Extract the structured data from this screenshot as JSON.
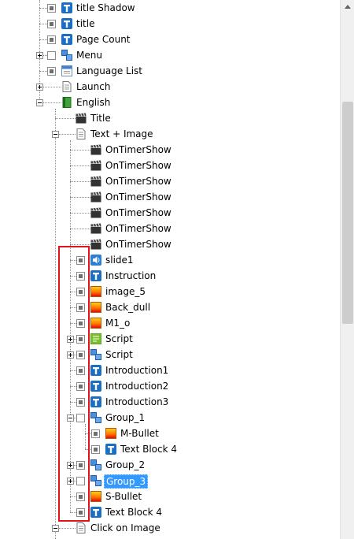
{
  "tree": [
    {
      "label": "title Shadow",
      "icon": "text-t-icon",
      "check": "ind",
      "expander": "",
      "depth": 1,
      "lastChild": false
    },
    {
      "label": "title",
      "icon": "text-t-icon",
      "check": "ind",
      "expander": "",
      "depth": 1,
      "lastChild": false
    },
    {
      "label": "Page Count",
      "icon": "text-t-icon",
      "check": "ind",
      "expander": "",
      "depth": 1,
      "lastChild": false
    },
    {
      "label": "Menu",
      "icon": "group-icon",
      "check": "empty",
      "expander": "plus",
      "depth": 1,
      "lastChild": false
    },
    {
      "label": "Language List",
      "icon": "dropdown-list-icon",
      "check": "ind",
      "expander": "",
      "depth": 1,
      "lastChild": false
    },
    {
      "label": "Launch",
      "icon": "page-icon",
      "check": "none",
      "expander": "plus",
      "depth": 1,
      "lastChild": false
    },
    {
      "label": "English",
      "icon": "book-icon",
      "check": "none",
      "expander": "minus",
      "depth": 1,
      "lastChild": false
    },
    {
      "label": "Title",
      "icon": "clapper-icon",
      "check": "none",
      "expander": "",
      "depth": 2,
      "lastChild": false
    },
    {
      "label": "Text + Image",
      "icon": "page-icon",
      "check": "none",
      "expander": "minus",
      "depth": 2,
      "lastChild": false
    },
    {
      "label": "OnTimerShow",
      "icon": "clapper-icon",
      "check": "none",
      "expander": "",
      "depth": 3,
      "lastChild": false
    },
    {
      "label": "OnTimerShow",
      "icon": "clapper-icon",
      "check": "none",
      "expander": "",
      "depth": 3,
      "lastChild": false
    },
    {
      "label": "OnTimerShow",
      "icon": "clapper-icon",
      "check": "none",
      "expander": "",
      "depth": 3,
      "lastChild": false
    },
    {
      "label": "OnTimerShow",
      "icon": "clapper-icon",
      "check": "none",
      "expander": "",
      "depth": 3,
      "lastChild": false
    },
    {
      "label": "OnTimerShow",
      "icon": "clapper-icon",
      "check": "none",
      "expander": "",
      "depth": 3,
      "lastChild": false
    },
    {
      "label": "OnTimerShow",
      "icon": "clapper-icon",
      "check": "none",
      "expander": "",
      "depth": 3,
      "lastChild": false
    },
    {
      "label": "OnTimerShow",
      "icon": "clapper-icon",
      "check": "none",
      "expander": "",
      "depth": 3,
      "lastChild": false
    },
    {
      "label": "slide1",
      "icon": "speaker-icon",
      "check": "ind",
      "expander": "",
      "depth": 3,
      "lastChild": false
    },
    {
      "label": "Instruction",
      "icon": "text-t-icon",
      "check": "ind",
      "expander": "",
      "depth": 3,
      "lastChild": false
    },
    {
      "label": "image_5",
      "icon": "image-icon",
      "check": "ind",
      "expander": "",
      "depth": 3,
      "lastChild": false
    },
    {
      "label": "Back_dull",
      "icon": "image-icon",
      "check": "ind",
      "expander": "",
      "depth": 3,
      "lastChild": false
    },
    {
      "label": "M1_o",
      "icon": "image-icon",
      "check": "ind",
      "expander": "",
      "depth": 3,
      "lastChild": false
    },
    {
      "label": "Script",
      "icon": "script-icon",
      "check": "ind",
      "expander": "plus",
      "depth": 3,
      "lastChild": false
    },
    {
      "label": "Script",
      "icon": "group-icon",
      "check": "ind",
      "expander": "plus",
      "depth": 3,
      "lastChild": false
    },
    {
      "label": "Introduction1",
      "icon": "text-t-icon",
      "check": "ind",
      "expander": "",
      "depth": 3,
      "lastChild": false
    },
    {
      "label": "Introduction2",
      "icon": "text-t-icon",
      "check": "ind",
      "expander": "",
      "depth": 3,
      "lastChild": false
    },
    {
      "label": "Introduction3",
      "icon": "text-t-icon",
      "check": "ind",
      "expander": "",
      "depth": 3,
      "lastChild": false
    },
    {
      "label": "Group_1",
      "icon": "group-icon",
      "check": "empty",
      "expander": "minus",
      "depth": 3,
      "lastChild": false
    },
    {
      "label": "M-Bullet",
      "icon": "image-icon",
      "check": "ind",
      "expander": "",
      "depth": 4,
      "lastChild": false
    },
    {
      "label": "Text Block 4",
      "icon": "text-t-icon",
      "check": "ind",
      "expander": "",
      "depth": 4,
      "lastChild": true
    },
    {
      "label": "Group_2",
      "icon": "group-icon",
      "check": "ind",
      "expander": "plus",
      "depth": 3,
      "lastChild": false
    },
    {
      "label": "Group_3",
      "icon": "group-icon",
      "check": "empty",
      "expander": "plus",
      "depth": 3,
      "lastChild": false,
      "selected": true
    },
    {
      "label": "S-Bullet",
      "icon": "image-icon",
      "check": "ind",
      "expander": "",
      "depth": 3,
      "lastChild": false
    },
    {
      "label": "Text Block 4",
      "icon": "text-t-icon",
      "check": "ind",
      "expander": "",
      "depth": 3,
      "lastChild": true
    },
    {
      "label": "Click on Image",
      "icon": "page-icon",
      "check": "none",
      "expander": "minus",
      "depth": 2,
      "lastChild": false
    }
  ],
  "colors": {
    "selection": "#3399ff",
    "highlight_box": "#e0121b",
    "text_icon": "#1a6fc4"
  }
}
